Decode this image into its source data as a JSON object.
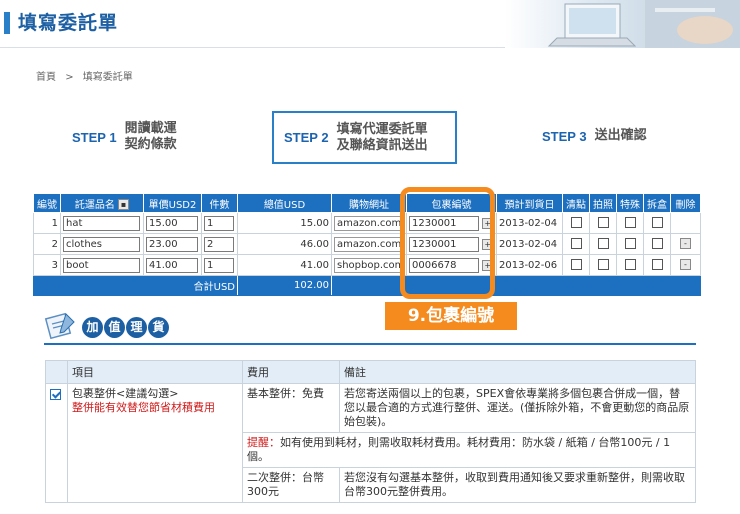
{
  "header": {
    "title": "填寫委託單"
  },
  "breadcrumb": [
    "首頁",
    ">",
    "填寫委託單"
  ],
  "steps": [
    {
      "num": "STEP 1",
      "line1": "閱讀載運",
      "line2": "契約條款"
    },
    {
      "num": "STEP 2",
      "line1": "填寫代運委託單",
      "line2": "及聯絡資訊送出"
    },
    {
      "num": "STEP 3",
      "line1": "送出確認",
      "line2": ""
    }
  ],
  "table": {
    "headers": [
      "編號",
      "託運品名",
      "單價USD2",
      "件數",
      "總值USD",
      "購物網址",
      "包裹編號",
      "預計到貨日",
      "清點",
      "拍照",
      "特殊",
      "拆盒",
      "刪除"
    ],
    "rows": [
      {
        "no": "1",
        "name": "hat",
        "price": "15.00",
        "qty": "1",
        "total": "15.00",
        "url": "amazon.com",
        "pkg": "1230001",
        "date": "2013-02-04"
      },
      {
        "no": "2",
        "name": "clothes",
        "price": "23.00",
        "qty": "2",
        "total": "46.00",
        "url": "amazon.com",
        "pkg": "1230001",
        "date": "2013-02-04"
      },
      {
        "no": "3",
        "name": "boot",
        "price": "41.00",
        "qty": "1",
        "total": "41.00",
        "url": "shopbop.com",
        "pkg": "0006678",
        "date": "2013-02-06"
      }
    ],
    "total_label": "合計USD",
    "total_value": "102.00"
  },
  "callout": {
    "label": "9.包裹編號"
  },
  "value_added": {
    "title_chars": [
      "加",
      "值",
      "理",
      "貨"
    ],
    "headers": [
      "項目",
      "費用",
      "備註"
    ],
    "item_name": "包裹整併<建議勾選>",
    "item_note": "整併能有效替您節省材積費用",
    "fee1": "基本整併：免費",
    "remark1": "若您寄送兩個以上的包裹，SPEX會依專業將多個包裹合併成一個，替您以最合適的方式進行整併、運送。(僅拆除外箱，不會更動您的商品原始包裝)。",
    "reminder_label": "提醒：",
    "reminder_text": "如有使用到耗材，則需收取耗材費用。耗材費用：防水袋 / 紙箱 / 台幣100元 / 1個。",
    "fee2": "二次整併：台幣300元",
    "remark2": "若您沒有勾選基本整併，收取到費用通知後又要求重新整併，則需收取台幣300元整併費用。"
  }
}
